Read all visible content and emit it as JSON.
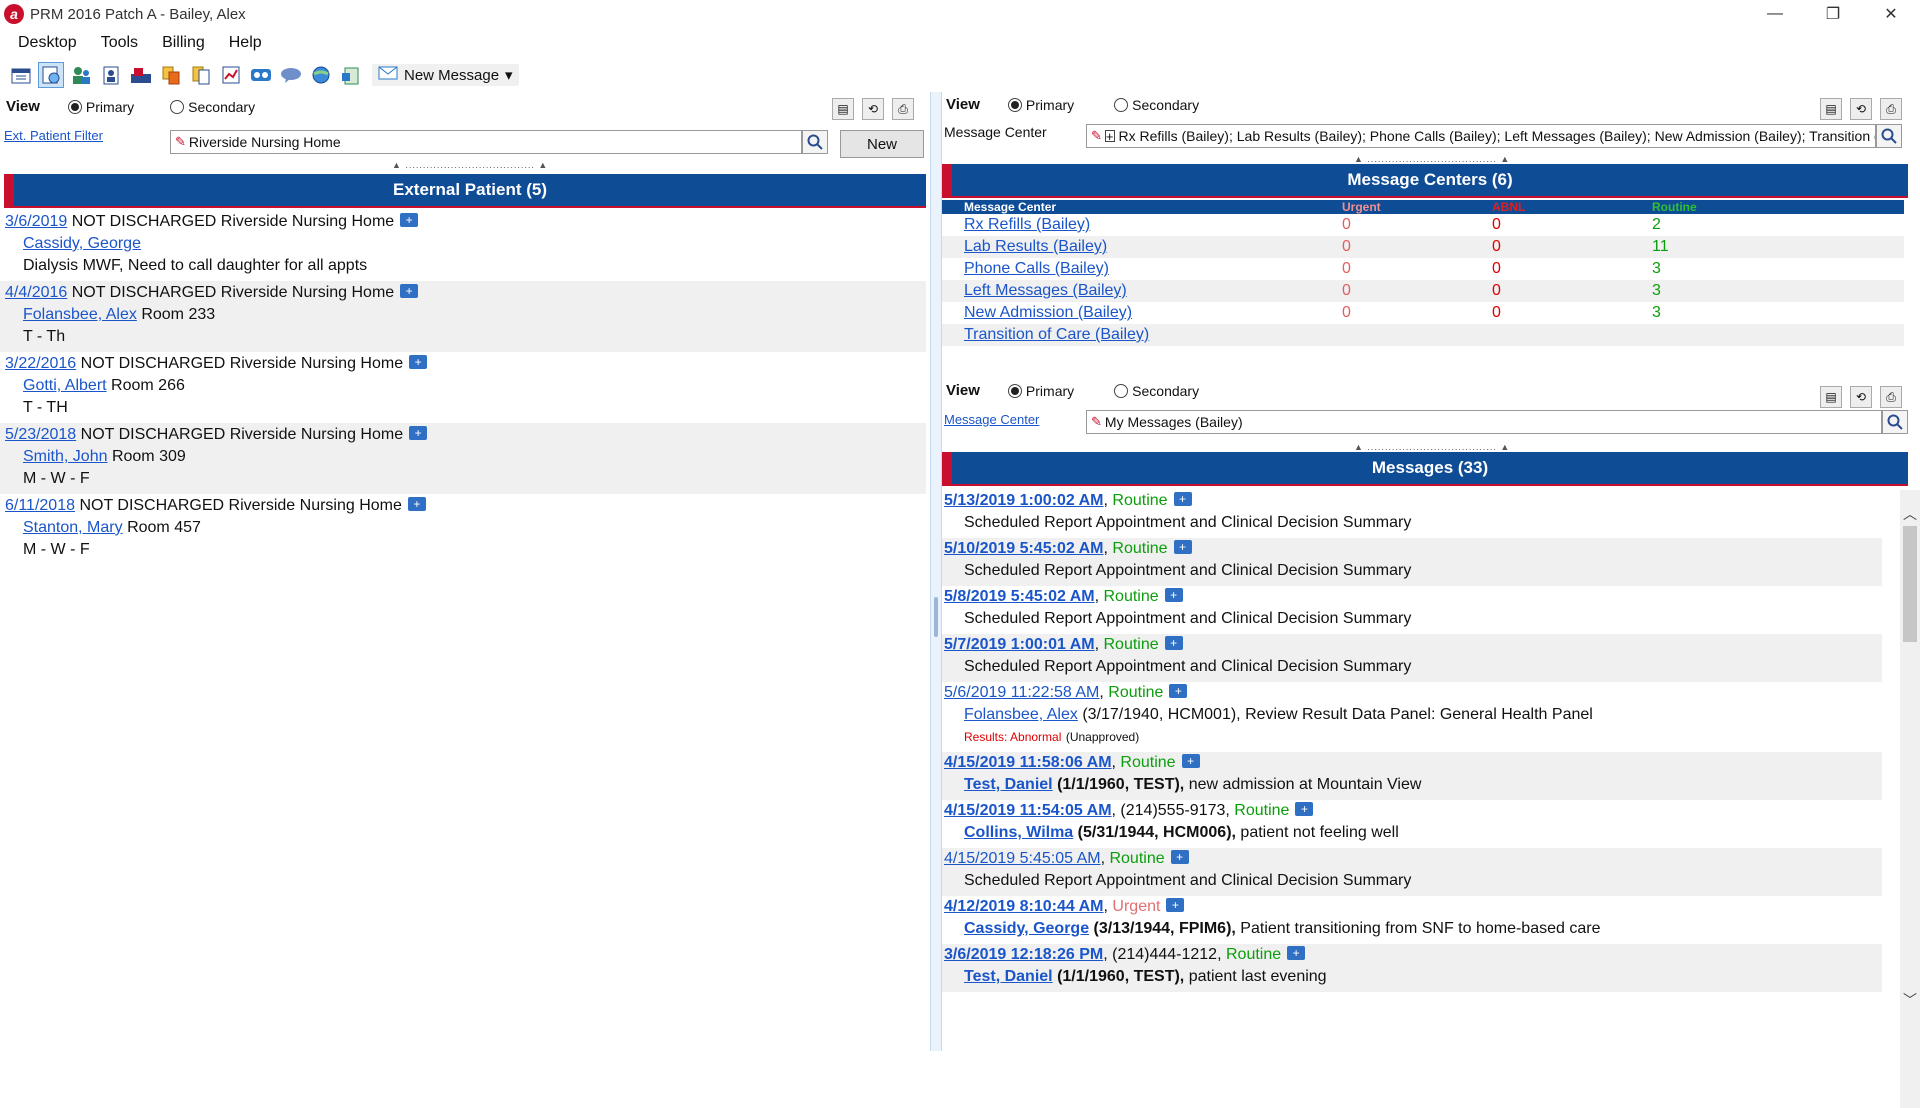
{
  "window": {
    "title": "PRM 2016 Patch A - Bailey, Alex",
    "minimize": "—",
    "restore": "❐",
    "close": "✕"
  },
  "menu": [
    "Desktop",
    "Tools",
    "Billing",
    "Help"
  ],
  "toolbar": {
    "icons": [
      "calendar-icon",
      "schedule-icon",
      "patients-icon",
      "chart-icon",
      "mailbox-icon",
      "tasks-icon",
      "documents-icon",
      "reports-icon",
      "voicemail-icon",
      "chat-icon",
      "globe-icon",
      "clipboard-icon"
    ],
    "new_message_label": "New Message",
    "dropdown": "▾"
  },
  "left": {
    "view_label": "View",
    "primary": "Primary",
    "secondary": "Secondary",
    "filter_link": "Ext. Patient Filter",
    "filter_value": "Riverside Nursing Home",
    "new_button": "New",
    "header": "External Patient (5)",
    "items": [
      {
        "date": "3/6/2019",
        "status": "NOT DISCHARGED Riverside Nursing Home",
        "patient": "Cassidy, George",
        "room": "",
        "note": "Dialysis MWF, Need to call daughter for all appts"
      },
      {
        "date": "4/4/2016",
        "status": "NOT DISCHARGED Riverside Nursing Home",
        "patient": "Folansbee, Alex",
        "room": "Room 233",
        "note": "T - Th"
      },
      {
        "date": "3/22/2016",
        "status": "NOT DISCHARGED Riverside Nursing Home",
        "patient": "Gotti, Albert",
        "room": "Room 266",
        "note": "T - TH"
      },
      {
        "date": "5/23/2018",
        "status": "NOT DISCHARGED Riverside Nursing Home",
        "patient": "Smith, John",
        "room": "Room 309",
        "note": "M - W - F"
      },
      {
        "date": "6/11/2018",
        "status": "NOT DISCHARGED Riverside Nursing Home",
        "patient": "Stanton, Mary",
        "room": "Room 457",
        "note": "M - W - F"
      }
    ]
  },
  "right": {
    "view_label": "View",
    "primary": "Primary",
    "secondary": "Secondary",
    "mc_label": "Message Center",
    "mc_value": "Rx Refills (Bailey); Lab Results (Bailey); Phone Calls (Bailey); Left Messages (Bailey); New Admission (Bailey); Transition of Care",
    "mc_header": "Message Centers (6)",
    "mc_columns": {
      "name": "Message Center",
      "urgent": "Urgent",
      "abnl": "ABNL",
      "routine": "Routine"
    },
    "mc_rows": [
      {
        "name": "Rx Refills (Bailey)",
        "urgent": "0",
        "abnl": "0",
        "routine": "2"
      },
      {
        "name": "Lab Results (Bailey)",
        "urgent": "0",
        "abnl": "0",
        "routine": "11"
      },
      {
        "name": "Phone Calls (Bailey)",
        "urgent": "0",
        "abnl": "0",
        "routine": "3"
      },
      {
        "name": "Left Messages (Bailey)",
        "urgent": "0",
        "abnl": "0",
        "routine": "3"
      },
      {
        "name": "New Admission (Bailey)",
        "urgent": "0",
        "abnl": "0",
        "routine": "3"
      },
      {
        "name": "Transition of Care (Bailey)",
        "urgent": "",
        "abnl": "",
        "routine": ""
      }
    ],
    "msg_view_label": "View",
    "msg_primary": "Primary",
    "msg_secondary": "Secondary",
    "msg_link": "Message Center",
    "msg_filter_value": "My Messages (Bailey)",
    "msg_header": "Messages (33)",
    "messages": [
      {
        "time": "5/13/2019 1:00:02 AM",
        "bold": true,
        "phone": "",
        "priority": "Routine",
        "patient": "",
        "patient_info": "",
        "text": "Scheduled Report Appointment and Clinical Decision Summary",
        "extra_abn": "",
        "extra_unapp": ""
      },
      {
        "time": "5/10/2019 5:45:02 AM",
        "bold": true,
        "phone": "",
        "priority": "Routine",
        "patient": "",
        "patient_info": "",
        "text": "Scheduled Report Appointment and Clinical Decision Summary",
        "extra_abn": "",
        "extra_unapp": ""
      },
      {
        "time": "5/8/2019 5:45:02 AM",
        "bold": true,
        "phone": "",
        "priority": "Routine",
        "patient": "",
        "patient_info": "",
        "text": "Scheduled Report Appointment and Clinical Decision Summary",
        "extra_abn": "",
        "extra_unapp": ""
      },
      {
        "time": "5/7/2019 1:00:01 AM",
        "bold": true,
        "phone": "",
        "priority": "Routine",
        "patient": "",
        "patient_info": "",
        "text": "Scheduled Report Appointment and Clinical Decision Summary",
        "extra_abn": "",
        "extra_unapp": ""
      },
      {
        "time": "5/6/2019 11:22:58 AM",
        "bold": false,
        "phone": "",
        "priority": "Routine",
        "patient": "Folansbee, Alex",
        "patient_info": "(3/17/1940, HCM001),",
        "text": "Review Result Data Panel: General Health Panel",
        "extra_abn": "Results: Abnormal",
        "extra_unapp": "(Unapproved)"
      },
      {
        "time": "4/15/2019 11:58:06 AM",
        "bold": true,
        "phone": "",
        "priority": "Routine",
        "patient": "Test, Daniel",
        "patient_info": "(1/1/1960, TEST),",
        "text": "new admission at Mountain View",
        "extra_abn": "",
        "extra_unapp": ""
      },
      {
        "time": "4/15/2019 11:54:05 AM",
        "bold": true,
        "phone": "(214)555-9173,",
        "priority": "Routine",
        "patient": "Collins, Wilma",
        "patient_info": "(5/31/1944, HCM006),",
        "text": "patient not feeling well",
        "extra_abn": "",
        "extra_unapp": ""
      },
      {
        "time": "4/15/2019 5:45:05 AM",
        "bold": false,
        "phone": "",
        "priority": "Routine",
        "patient": "",
        "patient_info": "",
        "text": "Scheduled Report Appointment and Clinical Decision Summary",
        "extra_abn": "",
        "extra_unapp": ""
      },
      {
        "time": "4/12/2019 8:10:44 AM",
        "bold": true,
        "phone": "",
        "priority": "Urgent",
        "patient": "Cassidy, George",
        "patient_info": "(3/13/1944, FPIM6),",
        "text": "Patient transitioning from SNF to home-based care",
        "extra_abn": "",
        "extra_unapp": ""
      },
      {
        "time": "3/6/2019 12:18:26 PM",
        "bold": true,
        "phone": "(214)444-1212,",
        "priority": "Routine",
        "patient": "Test, Daniel",
        "patient_info": "(1/1/1960, TEST),",
        "text": "patient last evening",
        "extra_abn": "",
        "extra_unapp": ""
      }
    ]
  }
}
